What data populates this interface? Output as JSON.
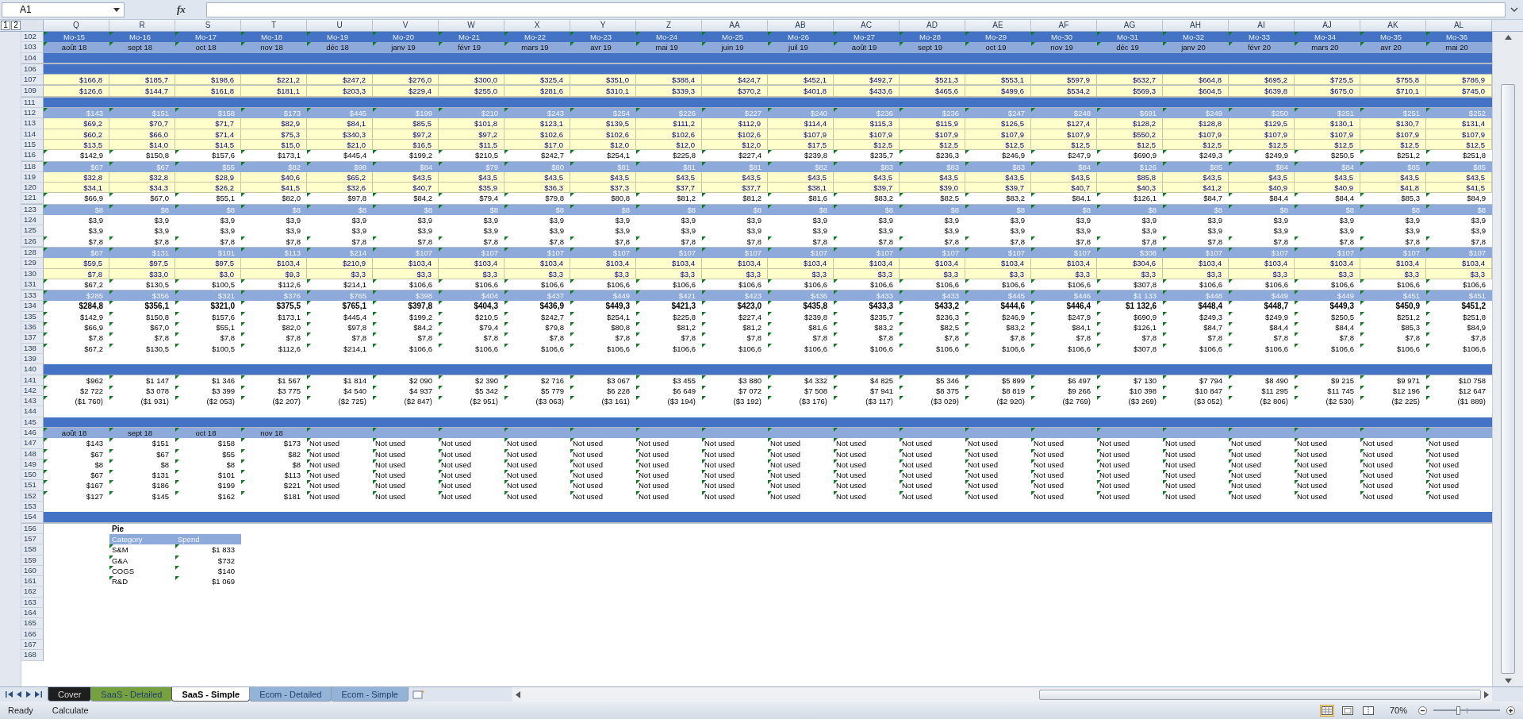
{
  "formula_bar": {
    "name_box": "A1",
    "function_label": "fx"
  },
  "outline_levels": [
    "1",
    "2"
  ],
  "columns": [
    "Q",
    "R",
    "S",
    "T",
    "U",
    "V",
    "W",
    "X",
    "Y",
    "Z",
    "AA",
    "AB",
    "AC",
    "AD",
    "AE",
    "AF",
    "AG",
    "AH",
    "AI",
    "AJ",
    "AK",
    "AL"
  ],
  "rows": [
    {
      "row": "102",
      "kind": "header",
      "flagged": true,
      "hidden_above": false,
      "cells": [
        "Mo-15",
        "Mo-16",
        "Mo-17",
        "Mo-18",
        "Mo-19",
        "Mo-20",
        "Mo-21",
        "Mo-22",
        "Mo-23",
        "Mo-24",
        "Mo-25",
        "Mo-26",
        "Mo-27",
        "Mo-28",
        "Mo-29",
        "Mo-30",
        "Mo-31",
        "Mo-32",
        "Mo-33",
        "Mo-34",
        "Mo-35",
        "Mo-36"
      ]
    },
    {
      "row": "103",
      "kind": "date",
      "flagged": true,
      "hidden_above": false,
      "cells": [
        "août 18",
        "sept 18",
        "oct 18",
        "nov 18",
        "déc 18",
        "janv 19",
        "févr 19",
        "mars 19",
        "avr 19",
        "mai 19",
        "juin 19",
        "juil 19",
        "août 19",
        "sept 19",
        "oct 19",
        "nov 19",
        "déc 19",
        "janv 20",
        "févr 20",
        "mars 20",
        "avr 20",
        "mai 20"
      ]
    },
    {
      "row": "104",
      "kind": "band",
      "hidden_above": false
    },
    {
      "row": "106",
      "kind": "band",
      "hidden_above": true
    },
    {
      "row": "107",
      "kind": "input",
      "flagged": false,
      "hidden_above": false,
      "cells": [
        "$166,8",
        "$185,7",
        "$198,6",
        "$221,2",
        "$247,2",
        "$276,0",
        "$300,0",
        "$325,4",
        "$351,0",
        "$388,4",
        "$424,7",
        "$452,1",
        "$492,7",
        "$521,3",
        "$553,1",
        "$597,9",
        "$632,7",
        "$664,8",
        "$695,2",
        "$725,5",
        "$755,8",
        "$786,9"
      ]
    },
    {
      "row": "109",
      "kind": "input",
      "flagged": false,
      "hidden_above": true,
      "cells": [
        "$126,6",
        "$144,7",
        "$161,8",
        "$181,1",
        "$203,3",
        "$229,4",
        "$255,0",
        "$281,6",
        "$310,1",
        "$339,3",
        "$370,2",
        "$401,8",
        "$433,6",
        "$465,6",
        "$499,6",
        "$534,2",
        "$569,3",
        "$604,5",
        "$639,8",
        "$675,0",
        "$710,1",
        "$745,0"
      ]
    },
    {
      "row": "111",
      "kind": "band",
      "hidden_above": true
    },
    {
      "row": "112",
      "kind": "subheader",
      "flagged": true,
      "hidden_above": false,
      "cells": [
        "$143",
        "$151",
        "$158",
        "$173",
        "$445",
        "$199",
        "$210",
        "$243",
        "$254",
        "$226",
        "$227",
        "$240",
        "$236",
        "$236",
        "$247",
        "$248",
        "$691",
        "$249",
        "$250",
        "$251",
        "$251",
        "$252"
      ]
    },
    {
      "row": "113",
      "kind": "input",
      "flagged": false,
      "hidden_above": false,
      "cells": [
        "$69,2",
        "$70,7",
        "$71,7",
        "$82,9",
        "$84,1",
        "$85,5",
        "$101,8",
        "$123,1",
        "$139,5",
        "$111,2",
        "$112,9",
        "$114,4",
        "$115,3",
        "$115,9",
        "$126,5",
        "$127,4",
        "$128,2",
        "$128,8",
        "$129,5",
        "$130,1",
        "$130,7",
        "$131,4"
      ]
    },
    {
      "row": "114",
      "kind": "input",
      "flagged": false,
      "hidden_above": false,
      "cells": [
        "$60,2",
        "$66,0",
        "$71,4",
        "$75,3",
        "$340,3",
        "$97,2",
        "$97,2",
        "$102,6",
        "$102,6",
        "$102,6",
        "$102,6",
        "$107,9",
        "$107,9",
        "$107,9",
        "$107,9",
        "$107,9",
        "$550,2",
        "$107,9",
        "$107,9",
        "$107,9",
        "$107,9",
        "$107,9"
      ]
    },
    {
      "row": "115",
      "kind": "input",
      "flagged": false,
      "hidden_above": false,
      "cells": [
        "$13,5",
        "$14,0",
        "$14,5",
        "$15,0",
        "$21,0",
        "$16,5",
        "$11,5",
        "$17,0",
        "$12,0",
        "$12,0",
        "$12,0",
        "$17,5",
        "$12,5",
        "$12,5",
        "$12,5",
        "$12,5",
        "$12,5",
        "$12,5",
        "$12,5",
        "$12,5",
        "$12,5",
        "$12,5"
      ]
    },
    {
      "row": "116",
      "kind": "value",
      "flagged": true,
      "hidden_above": false,
      "cells": [
        "$142,9",
        "$150,8",
        "$157,6",
        "$173,1",
        "$445,4",
        "$199,2",
        "$210,5",
        "$242,7",
        "$254,1",
        "$225,8",
        "$227,4",
        "$239,8",
        "$235,7",
        "$236,3",
        "$246,9",
        "$247,9",
        "$690,9",
        "$249,3",
        "$249,9",
        "$250,5",
        "$251,2",
        "$251,8"
      ]
    },
    {
      "row": "118",
      "kind": "subheader",
      "flagged": true,
      "hidden_above": true,
      "cells": [
        "$67",
        "$67",
        "$55",
        "$82",
        "$98",
        "$84",
        "$79",
        "$80",
        "$81",
        "$81",
        "$81",
        "$82",
        "$83",
        "$83",
        "$83",
        "$84",
        "$126",
        "$85",
        "$84",
        "$84",
        "$85",
        "$85"
      ]
    },
    {
      "row": "119",
      "kind": "input",
      "flagged": false,
      "hidden_above": false,
      "cells": [
        "$32,8",
        "$32,8",
        "$28,9",
        "$40,6",
        "$65,2",
        "$43,5",
        "$43,5",
        "$43,5",
        "$43,5",
        "$43,5",
        "$43,5",
        "$43,5",
        "$43,5",
        "$43,5",
        "$43,5",
        "$43,5",
        "$85,8",
        "$43,5",
        "$43,5",
        "$43,5",
        "$43,5",
        "$43,5"
      ]
    },
    {
      "row": "120",
      "kind": "input",
      "flagged": false,
      "hidden_above": false,
      "cells": [
        "$34,1",
        "$34,3",
        "$26,2",
        "$41,5",
        "$32,6",
        "$40,7",
        "$35,9",
        "$36,3",
        "$37,3",
        "$37,7",
        "$37,7",
        "$38,1",
        "$39,7",
        "$39,0",
        "$39,7",
        "$40,7",
        "$40,3",
        "$41,2",
        "$40,9",
        "$40,9",
        "$41,8",
        "$41,5"
      ]
    },
    {
      "row": "121",
      "kind": "value",
      "flagged": true,
      "hidden_above": false,
      "cells": [
        "$66,9",
        "$67,0",
        "$55,1",
        "$82,0",
        "$97,8",
        "$84,2",
        "$79,4",
        "$79,8",
        "$80,8",
        "$81,2",
        "$81,2",
        "$81,6",
        "$83,2",
        "$82,5",
        "$83,2",
        "$84,1",
        "$126,1",
        "$84,7",
        "$84,4",
        "$84,4",
        "$85,3",
        "$84,9"
      ]
    },
    {
      "row": "123",
      "kind": "subheader",
      "flagged": true,
      "hidden_above": true,
      "cells": [
        "$8",
        "$8",
        "$8",
        "$8",
        "$8",
        "$8",
        "$8",
        "$8",
        "$8",
        "$8",
        "$8",
        "$8",
        "$8",
        "$8",
        "$8",
        "$8",
        "$8",
        "$8",
        "$8",
        "$8",
        "$8",
        "$8"
      ]
    },
    {
      "row": "124",
      "kind": "value",
      "flagged": false,
      "hidden_above": false,
      "cells": [
        "$3,9",
        "$3,9",
        "$3,9",
        "$3,9",
        "$3,9",
        "$3,9",
        "$3,9",
        "$3,9",
        "$3,9",
        "$3,9",
        "$3,9",
        "$3,9",
        "$3,9",
        "$3,9",
        "$3,9",
        "$3,9",
        "$3,9",
        "$3,9",
        "$3,9",
        "$3,9",
        "$3,9",
        "$3,9"
      ]
    },
    {
      "row": "125",
      "kind": "value",
      "flagged": false,
      "hidden_above": false,
      "cells": [
        "$3,9",
        "$3,9",
        "$3,9",
        "$3,9",
        "$3,9",
        "$3,9",
        "$3,9",
        "$3,9",
        "$3,9",
        "$3,9",
        "$3,9",
        "$3,9",
        "$3,9",
        "$3,9",
        "$3,9",
        "$3,9",
        "$3,9",
        "$3,9",
        "$3,9",
        "$3,9",
        "$3,9",
        "$3,9"
      ]
    },
    {
      "row": "126",
      "kind": "value",
      "flagged": true,
      "hidden_above": false,
      "cells": [
        "$7,8",
        "$7,8",
        "$7,8",
        "$7,8",
        "$7,8",
        "$7,8",
        "$7,8",
        "$7,8",
        "$7,8",
        "$7,8",
        "$7,8",
        "$7,8",
        "$7,8",
        "$7,8",
        "$7,8",
        "$7,8",
        "$7,8",
        "$7,8",
        "$7,8",
        "$7,8",
        "$7,8",
        "$7,8"
      ]
    },
    {
      "row": "128",
      "kind": "subheader",
      "flagged": true,
      "hidden_above": true,
      "cells": [
        "$67",
        "$131",
        "$101",
        "$113",
        "$214",
        "$107",
        "$107",
        "$107",
        "$107",
        "$107",
        "$107",
        "$107",
        "$107",
        "$107",
        "$107",
        "$107",
        "$308",
        "$107",
        "$107",
        "$107",
        "$107",
        "$107"
      ]
    },
    {
      "row": "129",
      "kind": "input",
      "flagged": false,
      "hidden_above": false,
      "cells": [
        "$59,5",
        "$97,5",
        "$97,5",
        "$103,4",
        "$210,9",
        "$103,4",
        "$103,4",
        "$103,4",
        "$103,4",
        "$103,4",
        "$103,4",
        "$103,4",
        "$103,4",
        "$103,4",
        "$103,4",
        "$103,4",
        "$304,6",
        "$103,4",
        "$103,4",
        "$103,4",
        "$103,4",
        "$103,4"
      ]
    },
    {
      "row": "130",
      "kind": "input",
      "flagged": false,
      "hidden_above": false,
      "cells": [
        "$7,8",
        "$33,0",
        "$3,0",
        "$9,3",
        "$3,3",
        "$3,3",
        "$3,3",
        "$3,3",
        "$3,3",
        "$3,3",
        "$3,3",
        "$3,3",
        "$3,3",
        "$3,3",
        "$3,3",
        "$3,3",
        "$3,3",
        "$3,3",
        "$3,3",
        "$3,3",
        "$3,3",
        "$3,3"
      ]
    },
    {
      "row": "131",
      "kind": "value",
      "flagged": true,
      "hidden_above": false,
      "cells": [
        "$67,2",
        "$130,5",
        "$100,5",
        "$112,6",
        "$214,1",
        "$106,6",
        "$106,6",
        "$106,6",
        "$106,6",
        "$106,6",
        "$106,6",
        "$106,6",
        "$106,6",
        "$106,6",
        "$106,6",
        "$106,6",
        "$307,8",
        "$106,6",
        "$106,6",
        "$106,6",
        "$106,6",
        "$106,6"
      ]
    },
    {
      "row": "133",
      "kind": "subheader",
      "flagged": true,
      "hidden_above": true,
      "cells": [
        "$285",
        "$356",
        "$321",
        "$376",
        "$765",
        "$398",
        "$404",
        "$437",
        "$449",
        "$421",
        "$423",
        "$436",
        "$433",
        "$433",
        "$445",
        "$446",
        "$1 133",
        "$448",
        "$449",
        "$449",
        "$451",
        "$451"
      ]
    },
    {
      "row": "134",
      "kind": "total",
      "flagged": true,
      "hidden_above": false,
      "cells": [
        "$284,8",
        "$356,1",
        "$321,0",
        "$375,5",
        "$765,1",
        "$397,8",
        "$404,3",
        "$436,9",
        "$449,3",
        "$421,3",
        "$423,0",
        "$435,8",
        "$433,3",
        "$433,2",
        "$444,6",
        "$446,4",
        "$1 132,6",
        "$448,4",
        "$448,7",
        "$449,3",
        "$450,9",
        "$451,2"
      ]
    },
    {
      "row": "135",
      "kind": "value",
      "flagged": true,
      "hidden_above": false,
      "cells": [
        "$142,9",
        "$150,8",
        "$157,6",
        "$173,1",
        "$445,4",
        "$199,2",
        "$210,5",
        "$242,7",
        "$254,1",
        "$225,8",
        "$227,4",
        "$239,8",
        "$235,7",
        "$236,3",
        "$246,9",
        "$247,9",
        "$690,9",
        "$249,3",
        "$249,9",
        "$250,5",
        "$251,2",
        "$251,8"
      ]
    },
    {
      "row": "136",
      "kind": "value",
      "flagged": true,
      "hidden_above": false,
      "cells": [
        "$66,9",
        "$67,0",
        "$55,1",
        "$82,0",
        "$97,8",
        "$84,2",
        "$79,4",
        "$79,8",
        "$80,8",
        "$81,2",
        "$81,2",
        "$81,6",
        "$83,2",
        "$82,5",
        "$83,2",
        "$84,1",
        "$126,1",
        "$84,7",
        "$84,4",
        "$84,4",
        "$85,3",
        "$84,9"
      ]
    },
    {
      "row": "137",
      "kind": "value",
      "flagged": true,
      "hidden_above": false,
      "cells": [
        "$7,8",
        "$7,8",
        "$7,8",
        "$7,8",
        "$7,8",
        "$7,8",
        "$7,8",
        "$7,8",
        "$7,8",
        "$7,8",
        "$7,8",
        "$7,8",
        "$7,8",
        "$7,8",
        "$7,8",
        "$7,8",
        "$7,8",
        "$7,8",
        "$7,8",
        "$7,8",
        "$7,8",
        "$7,8"
      ]
    },
    {
      "row": "138",
      "kind": "value",
      "flagged": true,
      "hidden_above": false,
      "cells": [
        "$67,2",
        "$130,5",
        "$100,5",
        "$112,6",
        "$214,1",
        "$106,6",
        "$106,6",
        "$106,6",
        "$106,6",
        "$106,6",
        "$106,6",
        "$106,6",
        "$106,6",
        "$106,6",
        "$106,6",
        "$106,6",
        "$307,8",
        "$106,6",
        "$106,6",
        "$106,6",
        "$106,6",
        "$106,6"
      ]
    },
    {
      "row": "139",
      "kind": "blank",
      "hidden_above": false
    },
    {
      "row": "140",
      "kind": "band",
      "hidden_above": false
    },
    {
      "row": "141",
      "kind": "value",
      "flagged": true,
      "hidden_above": false,
      "cells": [
        "$962",
        "$1 147",
        "$1 346",
        "$1 567",
        "$1 814",
        "$2 090",
        "$2 390",
        "$2 716",
        "$3 067",
        "$3 455",
        "$3 880",
        "$4 332",
        "$4 825",
        "$5 346",
        "$5 899",
        "$6 497",
        "$7 130",
        "$7 794",
        "$8 490",
        "$9 215",
        "$9 971",
        "$10 758"
      ]
    },
    {
      "row": "142",
      "kind": "value",
      "flagged": true,
      "hidden_above": false,
      "cells": [
        "$2 722",
        "$3 078",
        "$3 399",
        "$3 775",
        "$4 540",
        "$4 937",
        "$5 342",
        "$5 779",
        "$6 228",
        "$6 649",
        "$7 072",
        "$7 508",
        "$7 941",
        "$8 375",
        "$8 819",
        "$9 266",
        "$10 398",
        "$10 847",
        "$11 295",
        "$11 745",
        "$12 196",
        "$12 647"
      ]
    },
    {
      "row": "143",
      "kind": "value",
      "flagged": true,
      "hidden_above": false,
      "cells": [
        "($1 760)",
        "($1 931)",
        "($2 053)",
        "($2 207)",
        "($2 725)",
        "($2 847)",
        "($2 951)",
        "($3 063)",
        "($3 161)",
        "($3 194)",
        "($3 192)",
        "($3 176)",
        "($3 117)",
        "($3 029)",
        "($2 920)",
        "($2 769)",
        "($3 269)",
        "($3 052)",
        "($2 806)",
        "($2 530)",
        "($2 225)",
        "($1 889)"
      ]
    },
    {
      "row": "144",
      "kind": "blank",
      "hidden_above": false
    },
    {
      "row": "145",
      "kind": "band",
      "hidden_above": false
    },
    {
      "row": "146",
      "kind": "date",
      "flagged": true,
      "hidden_above": false,
      "cells": [
        "août 18",
        "sept 18",
        "oct 18",
        "nov 18"
      ]
    },
    {
      "row": "147",
      "kind": "mixed",
      "flagged": true,
      "hidden_above": false,
      "cells": [
        "$143",
        "$151",
        "$158",
        "$173"
      ],
      "unused": [
        "Not used",
        "Not used",
        "Not used",
        "Not used",
        "Not used",
        "Not used",
        "Not used",
        "Not used",
        "Not used",
        "Not used",
        "Not used",
        "Not used",
        "Not used",
        "Not used",
        "Not used",
        "Not used",
        "Not used",
        "Not used"
      ]
    },
    {
      "row": "148",
      "kind": "mixed",
      "flagged": true,
      "hidden_above": false,
      "cells": [
        "$67",
        "$67",
        "$55",
        "$82"
      ],
      "unused": [
        "Not used",
        "Not used",
        "Not used",
        "Not used",
        "Not used",
        "Not used",
        "Not used",
        "Not used",
        "Not used",
        "Not used",
        "Not used",
        "Not used",
        "Not used",
        "Not used",
        "Not used",
        "Not used",
        "Not used",
        "Not used"
      ]
    },
    {
      "row": "149",
      "kind": "mixed",
      "flagged": true,
      "hidden_above": false,
      "cells": [
        "$8",
        "$8",
        "$8",
        "$8"
      ],
      "unused": [
        "Not used",
        "Not used",
        "Not used",
        "Not used",
        "Not used",
        "Not used",
        "Not used",
        "Not used",
        "Not used",
        "Not used",
        "Not used",
        "Not used",
        "Not used",
        "Not used",
        "Not used",
        "Not used",
        "Not used",
        "Not used"
      ]
    },
    {
      "row": "150",
      "kind": "mixed",
      "flagged": true,
      "hidden_above": false,
      "cells": [
        "$67",
        "$131",
        "$101",
        "$113"
      ],
      "unused": [
        "Not used",
        "Not used",
        "Not used",
        "Not used",
        "Not used",
        "Not used",
        "Not used",
        "Not used",
        "Not used",
        "Not used",
        "Not used",
        "Not used",
        "Not used",
        "Not used",
        "Not used",
        "Not used",
        "Not used",
        "Not used"
      ]
    },
    {
      "row": "151",
      "kind": "mixed",
      "flagged": true,
      "hidden_above": false,
      "cells": [
        "$167",
        "$186",
        "$199",
        "$221"
      ],
      "unused": [
        "Not used",
        "Not used",
        "Not used",
        "Not used",
        "Not used",
        "Not used",
        "Not used",
        "Not used",
        "Not used",
        "Not used",
        "Not used",
        "Not used",
        "Not used",
        "Not used",
        "Not used",
        "Not used",
        "Not used",
        "Not used"
      ]
    },
    {
      "row": "152",
      "kind": "mixed",
      "flagged": true,
      "hidden_above": false,
      "cells": [
        "$127",
        "$145",
        "$162",
        "$181"
      ],
      "unused": [
        "Not used",
        "Not used",
        "Not used",
        "Not used",
        "Not used",
        "Not used",
        "Not used",
        "Not used",
        "Not used",
        "Not used",
        "Not used",
        "Not used",
        "Not used",
        "Not used",
        "Not used",
        "Not used",
        "Not used",
        "Not used"
      ]
    },
    {
      "row": "153",
      "kind": "blank",
      "hidden_above": false
    },
    {
      "row": "154",
      "kind": "band",
      "hidden_above": false
    },
    {
      "row": "156",
      "kind": "pie-title",
      "hidden_above": true,
      "cells": [
        "Pie"
      ]
    },
    {
      "row": "157",
      "kind": "pie-head",
      "hidden_above": false,
      "cells": [
        "Category",
        "Spend"
      ]
    },
    {
      "row": "158",
      "kind": "pie-row",
      "flagged": true,
      "hidden_above": false,
      "cells": [
        "S&M",
        "$1 833"
      ]
    },
    {
      "row": "159",
      "kind": "pie-row",
      "flagged": true,
      "hidden_above": false,
      "cells": [
        "G&A",
        "$732"
      ]
    },
    {
      "row": "160",
      "kind": "pie-row",
      "flagged": true,
      "hidden_above": false,
      "cells": [
        "COGS",
        "$140"
      ]
    },
    {
      "row": "161",
      "kind": "pie-row",
      "flagged": true,
      "hidden_above": false,
      "cells": [
        "R&D",
        "$1 069"
      ]
    },
    {
      "row": "162",
      "kind": "blank",
      "hidden_above": false
    },
    {
      "row": "163",
      "kind": "blank",
      "hidden_above": false
    },
    {
      "row": "164",
      "kind": "blank",
      "hidden_above": false
    },
    {
      "row": "165",
      "kind": "blank",
      "hidden_above": false
    },
    {
      "row": "166",
      "kind": "blank",
      "hidden_above": false
    },
    {
      "row": "167",
      "kind": "blank",
      "hidden_above": false
    },
    {
      "row": "168",
      "kind": "blank",
      "hidden_above": false
    }
  ],
  "sheet_tabs": [
    {
      "label": "Cover",
      "selected": false,
      "color": "#1e1e1e"
    },
    {
      "label": "SaaS - Detailed",
      "selected": false,
      "color": "#77a03f"
    },
    {
      "label": "SaaS - Simple",
      "selected": true,
      "color": "#ffffff"
    },
    {
      "label": "Ecom - Detailed",
      "selected": false,
      "color": "#95b3d7"
    },
    {
      "label": "Ecom - Simple",
      "selected": false,
      "color": "#95b3d7"
    }
  ],
  "status_bar": {
    "mode": "Ready",
    "calculate": "Calculate",
    "zoom": "70%",
    "zoom_slider": {
      "level": 0.37
    }
  }
}
